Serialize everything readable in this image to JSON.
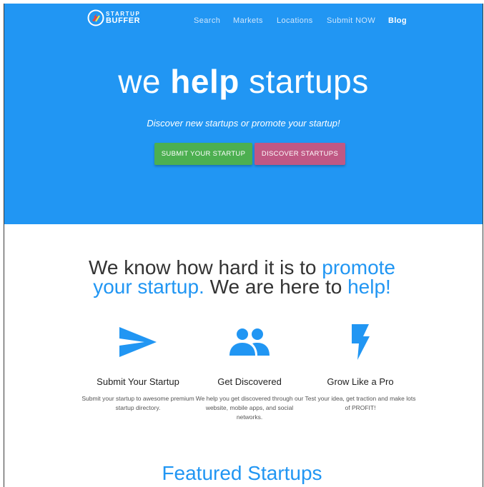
{
  "brand": {
    "line1": "STARTUP",
    "line2": "BUFFER"
  },
  "nav": {
    "items": [
      {
        "label": "Search"
      },
      {
        "label": "Markets"
      },
      {
        "label": "Locations"
      },
      {
        "label": "Submit NOW"
      },
      {
        "label": "Blog"
      }
    ]
  },
  "hero": {
    "title_pre": "we ",
    "title_bold": "help",
    "title_post": " startups",
    "subtitle": "Discover new startups or promote your startup!",
    "submit_button": "SUBMIT YOUR STARTUP",
    "discover_button": "DISCOVER STARTUPS"
  },
  "promo": {
    "part1": "We know how hard it is to ",
    "part2": "promote",
    "part3": "your startup.",
    "part4": " We are here to ",
    "part5": "help!"
  },
  "features": [
    {
      "icon": "send-icon",
      "title": "Submit Your Startup",
      "text": "Submit your startup to awesome premium startup directory."
    },
    {
      "icon": "people-icon",
      "title": "Get Discovered",
      "text": "We help you get discovered through our website, mobile apps, and social networks."
    },
    {
      "icon": "flash-icon",
      "title": "Grow Like a Pro",
      "text": "Test your idea, get traction and make lots of PROFIT!"
    }
  ],
  "featured": {
    "title": "Featured Startups"
  },
  "colors": {
    "primary": "#2196f3",
    "green": "#4caf50",
    "pink": "#c05884"
  }
}
